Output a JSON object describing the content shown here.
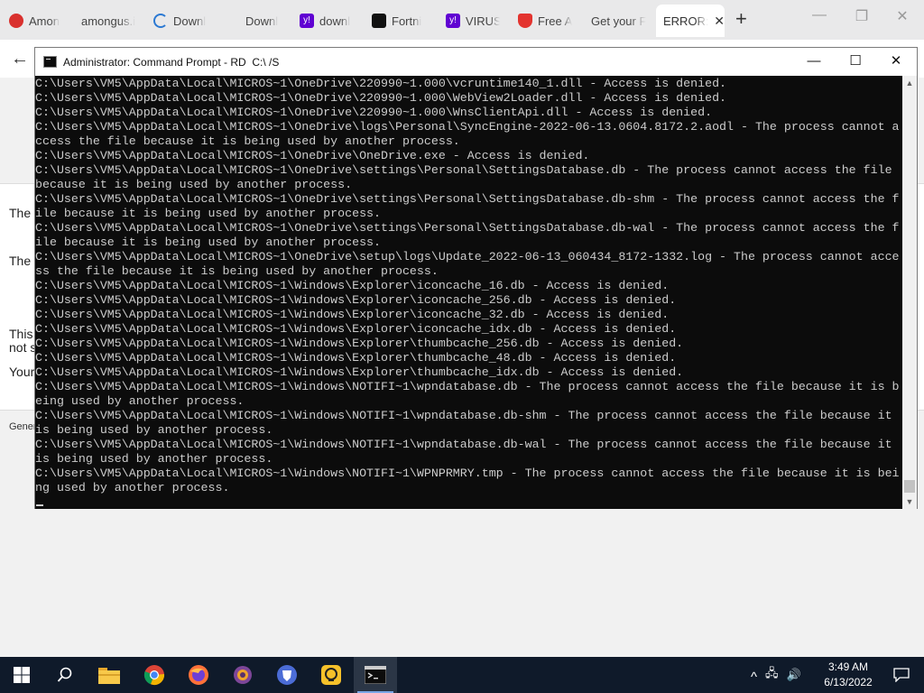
{
  "browser": {
    "tabs": [
      {
        "label": "Amon",
        "icon_color": "#d9312e",
        "icon": "amongus-icon"
      },
      {
        "label": "amongus.i",
        "icon_color": "#e9e9ea",
        "icon": "blank-icon"
      },
      {
        "label": "Downl",
        "icon_color": "#2b79d3",
        "icon": "loading-icon"
      },
      {
        "label": "Downl",
        "icon_color": "#e9e9ea",
        "icon": "blank-icon"
      },
      {
        "label": "downl",
        "icon_color": "#6001d2",
        "icon": "yahoo-icon"
      },
      {
        "label": "Fortni",
        "icon_color": "#111111",
        "icon": "epic-icon"
      },
      {
        "label": "VIRUS",
        "icon_color": "#6001d2",
        "icon": "yahoo-icon"
      },
      {
        "label": "Free A",
        "icon_color": "#e3342f",
        "icon": "shield-icon"
      },
      {
        "label": "Get your F",
        "icon_color": "#e9e9ea",
        "icon": "blank-icon"
      }
    ],
    "active_tab": {
      "label": "ERROR:",
      "close": "✕"
    },
    "new_tab": "+",
    "controls": {
      "minimize": "—",
      "restore": "❐",
      "close": "✕"
    },
    "back": "←",
    "page_lines": [
      "The",
      "The",
      "This",
      "not s",
      "Your"
    ],
    "page_footer": "Gener"
  },
  "cmd": {
    "title": "Administrator: Command Prompt - RD  C:\\ /S",
    "controls": {
      "minimize": "—",
      "maximize": "☐",
      "close": "✕"
    },
    "lines": [
      "C:\\Users\\VM5\\AppData\\Local\\MICROS~1\\OneDrive\\220990~1.000\\vcruntime140_1.dll - Access is denied.",
      "C:\\Users\\VM5\\AppData\\Local\\MICROS~1\\OneDrive\\220990~1.000\\WebView2Loader.dll - Access is denied.",
      "C:\\Users\\VM5\\AppData\\Local\\MICROS~1\\OneDrive\\220990~1.000\\WnsClientApi.dll - Access is denied.",
      "C:\\Users\\VM5\\AppData\\Local\\MICROS~1\\OneDrive\\logs\\Personal\\SyncEngine-2022-06-13.0604.8172.2.aodl - The process cannot a",
      "ccess the file because it is being used by another process.",
      "C:\\Users\\VM5\\AppData\\Local\\MICROS~1\\OneDrive\\OneDrive.exe - Access is denied.",
      "C:\\Users\\VM5\\AppData\\Local\\MICROS~1\\OneDrive\\settings\\Personal\\SettingsDatabase.db - The process cannot access the file",
      "because it is being used by another process.",
      "C:\\Users\\VM5\\AppData\\Local\\MICROS~1\\OneDrive\\settings\\Personal\\SettingsDatabase.db-shm - The process cannot access the f",
      "ile because it is being used by another process.",
      "C:\\Users\\VM5\\AppData\\Local\\MICROS~1\\OneDrive\\settings\\Personal\\SettingsDatabase.db-wal - The process cannot access the f",
      "ile because it is being used by another process.",
      "C:\\Users\\VM5\\AppData\\Local\\MICROS~1\\OneDrive\\setup\\logs\\Update_2022-06-13_060434_8172-1332.log - The process cannot acce",
      "ss the file because it is being used by another process.",
      "C:\\Users\\VM5\\AppData\\Local\\MICROS~1\\Windows\\Explorer\\iconcache_16.db - Access is denied.",
      "C:\\Users\\VM5\\AppData\\Local\\MICROS~1\\Windows\\Explorer\\iconcache_256.db - Access is denied.",
      "C:\\Users\\VM5\\AppData\\Local\\MICROS~1\\Windows\\Explorer\\iconcache_32.db - Access is denied.",
      "C:\\Users\\VM5\\AppData\\Local\\MICROS~1\\Windows\\Explorer\\iconcache_idx.db - Access is denied.",
      "C:\\Users\\VM5\\AppData\\Local\\MICROS~1\\Windows\\Explorer\\thumbcache_256.db - Access is denied.",
      "C:\\Users\\VM5\\AppData\\Local\\MICROS~1\\Windows\\Explorer\\thumbcache_48.db - Access is denied.",
      "C:\\Users\\VM5\\AppData\\Local\\MICROS~1\\Windows\\Explorer\\thumbcache_idx.db - Access is denied.",
      "C:\\Users\\VM5\\AppData\\Local\\MICROS~1\\Windows\\NOTIFI~1\\wpndatabase.db - The process cannot access the file because it is b",
      "eing used by another process.",
      "C:\\Users\\VM5\\AppData\\Local\\MICROS~1\\Windows\\NOTIFI~1\\wpndatabase.db-shm - The process cannot access the file because it",
      "is being used by another process.",
      "C:\\Users\\VM5\\AppData\\Local\\MICROS~1\\Windows\\NOTIFI~1\\wpndatabase.db-wal - The process cannot access the file because it",
      "is being used by another process.",
      "C:\\Users\\VM5\\AppData\\Local\\MICROS~1\\Windows\\NOTIFI~1\\WPNPRMRY.tmp - The process cannot access the file because it is bei",
      "ng used by another process."
    ]
  },
  "taskbar": {
    "items": [
      "start-icon",
      "search-icon",
      "file-explorer-icon",
      "chrome-icon",
      "firefox-icon",
      "tor-icon",
      "brave-icon",
      "remote-icon",
      "terminal-icon"
    ],
    "tray": {
      "chevron": "^",
      "network": "🖧",
      "volume": "🔊"
    },
    "clock": {
      "time": "3:49 AM",
      "date": "6/13/2022"
    }
  }
}
